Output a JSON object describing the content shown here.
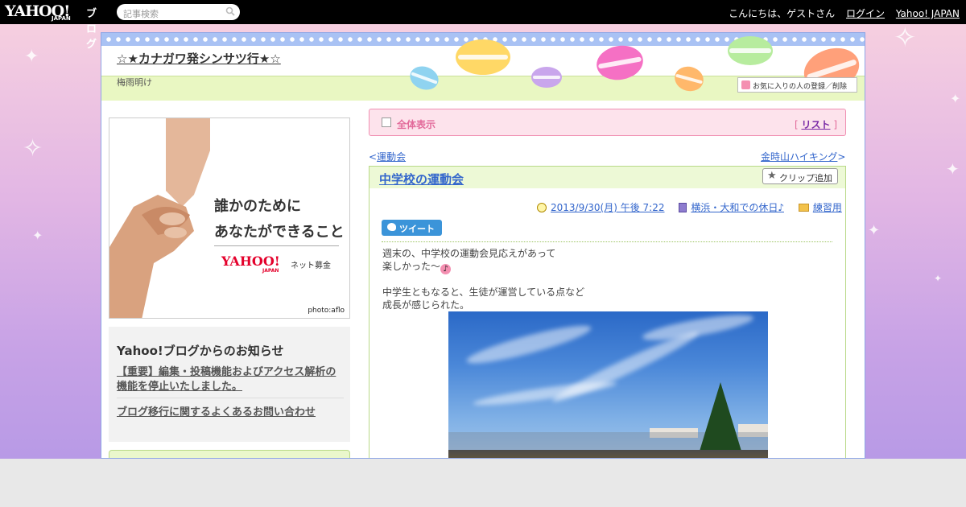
{
  "topbar": {
    "logo_yahoo": "YAHOO!",
    "logo_japan": "JAPAN",
    "logo_blog": "ブログ",
    "search_placeholder": "記事検索",
    "greeting": "こんにちは、ゲストさん",
    "login": "ログイン",
    "yahoo_japan": "Yahoo! JAPAN"
  },
  "blog": {
    "title": "☆★カナガワ発シンサツ行★☆",
    "description": "梅雨明け",
    "fav_button": "お気に入りの人の登録／削除"
  },
  "ad": {
    "line1": "誰かのために",
    "line2": "あなたができること",
    "brand": "YAHOO!",
    "brand_sub": "JAPAN",
    "service": "ネット募金",
    "credit": "photo:aflo"
  },
  "notice": {
    "title": "Yahoo!ブログからのお知らせ",
    "link1": "【重要】編集・投稿機能およびアクセス解析の機能を停止いたしました。",
    "link2": "ブログ移行に関するよくあるお問い合わせ"
  },
  "fullview": {
    "label": "全体表示",
    "list_open": "[",
    "list": "リスト",
    "list_close": "]"
  },
  "nav": {
    "prev_arrow": "<",
    "prev": "運動会",
    "next": "金時山ハイキング",
    "next_arrow": ">"
  },
  "article": {
    "title": "中学校の運動会",
    "clip_button": "クリップ追加",
    "datetime": "2013/9/30(月) 午後 7:22",
    "category": "横浜・大和での休日♪",
    "folder": "練習用",
    "tweet": "ツイート",
    "body": [
      "週末の、中学校の運動会見応えがあって",
      "楽しかった～",
      "",
      "中学生ともなると、生徒が運営している点など",
      "成長が感じられた。"
    ],
    "note_glyph": "♪"
  },
  "colors": {
    "topbar": "#000000",
    "accent_pink": "#e26a9a",
    "link_blue": "#3366cc",
    "header_green": "#e9f7c2",
    "dots_blue": "#a9c2f4"
  }
}
